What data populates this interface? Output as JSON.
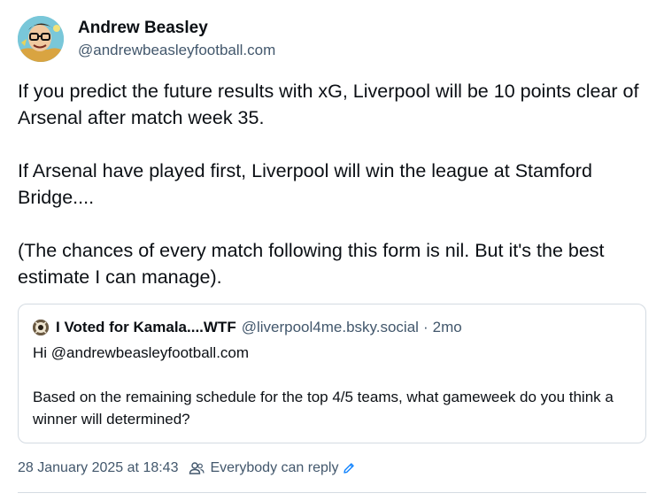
{
  "author": {
    "display_name": "Andrew Beasley",
    "handle": "@andrewbeasleyfootball.com",
    "avatar_icon": "cartoon-man-with-glasses-avatar"
  },
  "post": {
    "paragraphs": [
      "If you predict the future results with xG, Liverpool will be 10 points clear of Arsenal after match week 35.",
      "If Arsenal have played first, Liverpool will win the league at Stamford Bridge....",
      "(The chances of every match following this form is nil. But it's the best estimate I can manage)."
    ]
  },
  "quoted_post": {
    "display_name": "I Voted for Kamala....WTF",
    "handle": "@liverpool4me.bsky.social",
    "separator": "·",
    "time": "2mo",
    "paragraphs": [
      "Hi @andrewbeasleyfootball.com",
      "Based on the remaining schedule for the top 4/5 teams, what gameweek do you think a winner will determined?"
    ]
  },
  "footer": {
    "timestamp": "28 January 2025 at 18:43",
    "reply_setting": "Everybody can reply"
  },
  "colors": {
    "text": "#0b0f14",
    "muted": "#42576c",
    "border": "#d4dbe2",
    "accent": "#1083fe"
  }
}
